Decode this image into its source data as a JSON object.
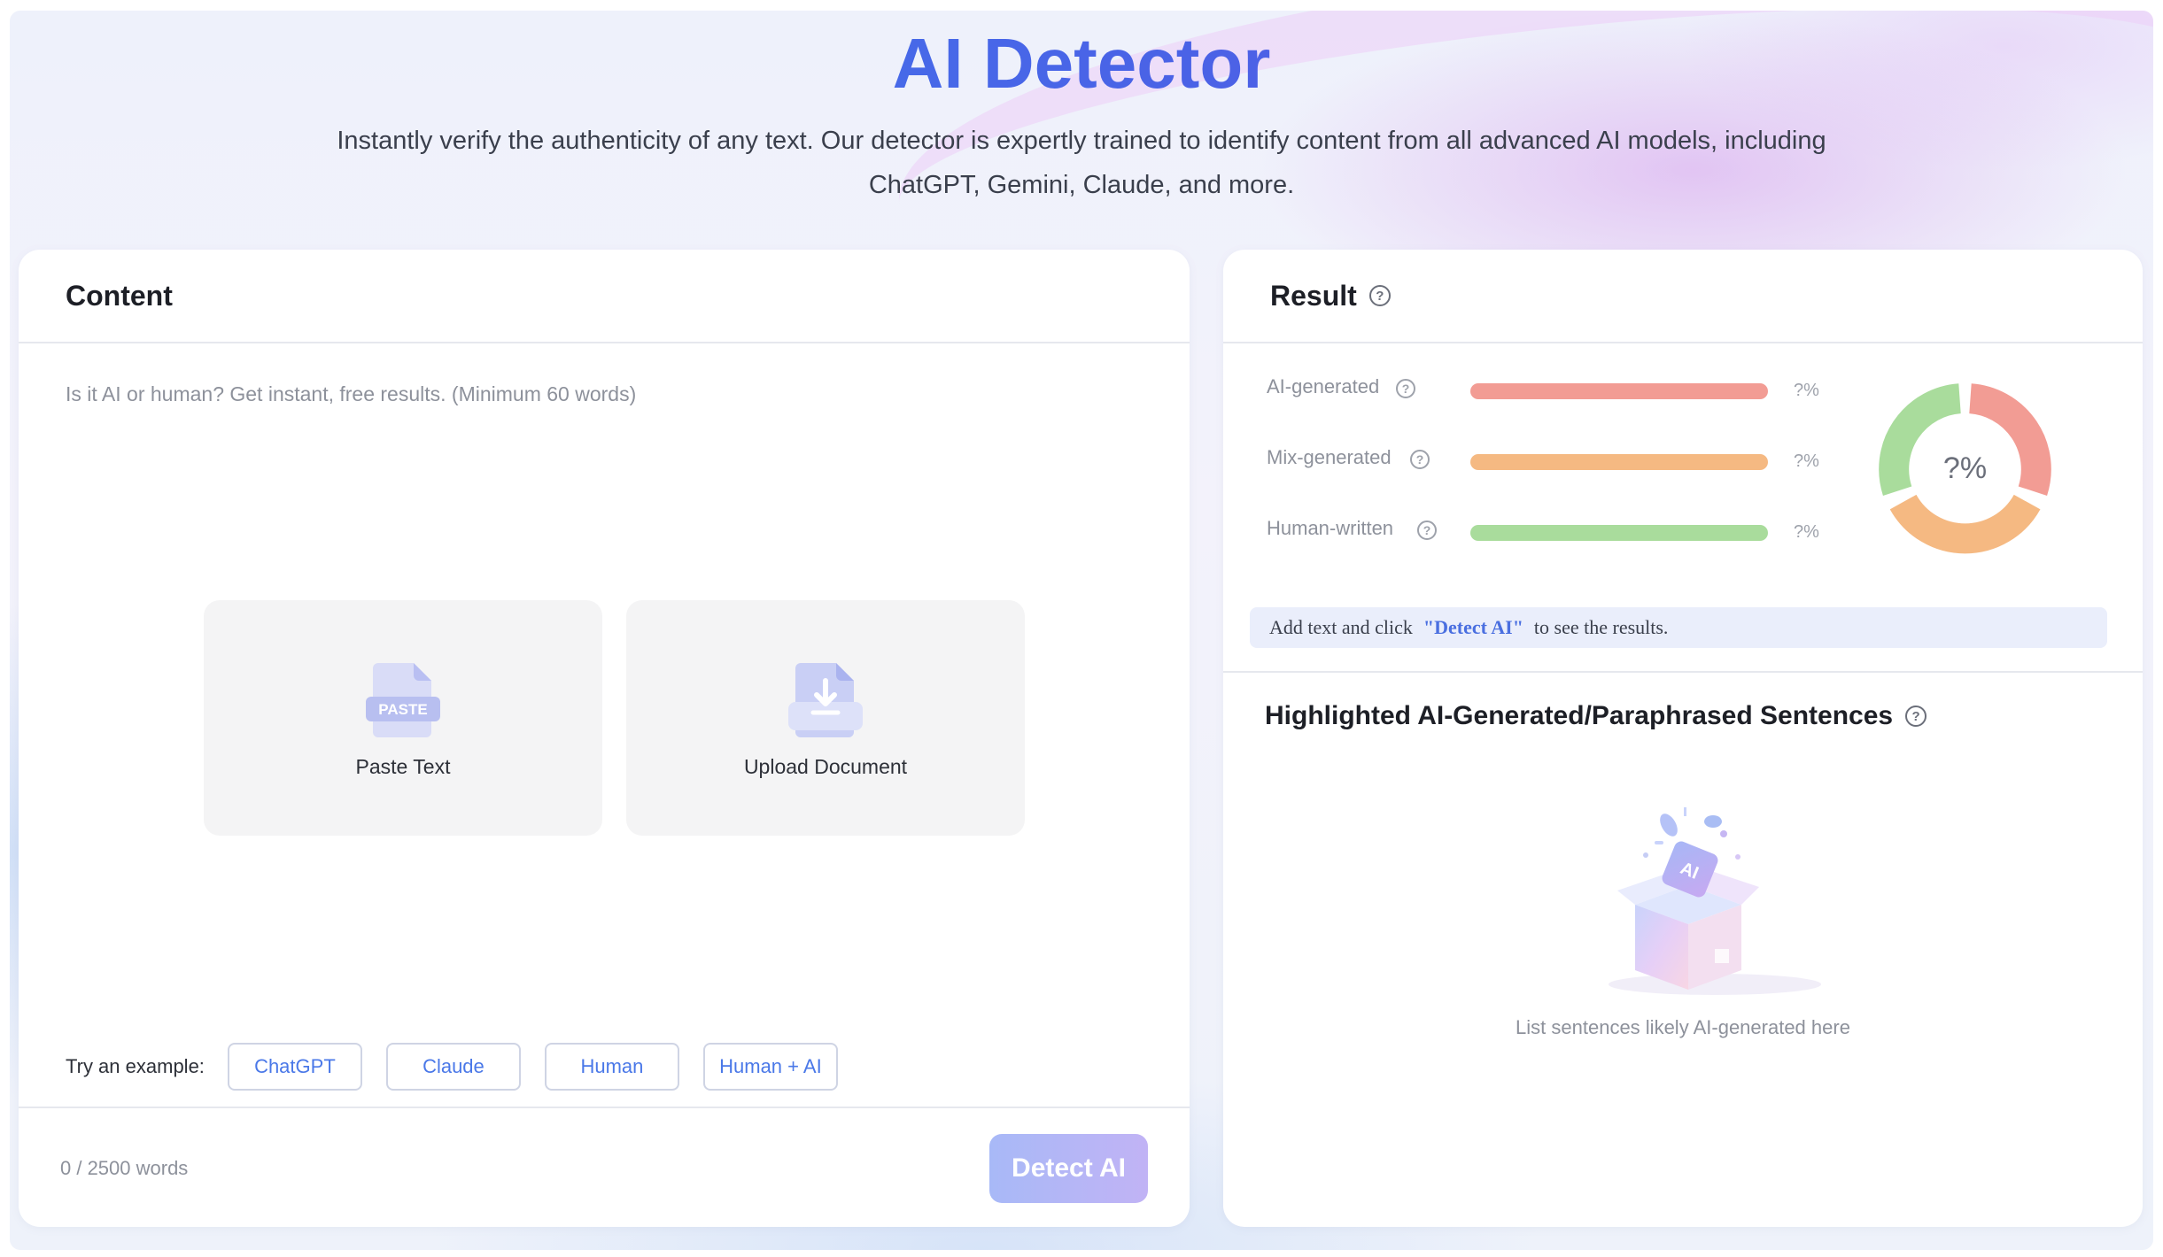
{
  "header": {
    "title": "AI Detector",
    "subtitle_line1": "Instantly verify the authenticity of any text. Our detector is expertly trained to identify content from all advanced AI models, including",
    "subtitle_line2": "ChatGPT, Gemini, Claude, and more."
  },
  "content_panel": {
    "title": "Content",
    "placeholder": "Is it AI or human? Get instant, free results. (Minimum 60 words)",
    "paste_label": "Paste Text",
    "paste_icon_text": "PASTE",
    "upload_label": "Upload Document",
    "examples_label": "Try an example:",
    "examples": [
      "ChatGPT",
      "Claude",
      "Human",
      "Human + AI"
    ],
    "word_count": "0 / 2500 words",
    "detect_button": "Detect AI"
  },
  "result_panel": {
    "title": "Result",
    "metrics": [
      {
        "label": "AI-generated",
        "value": "?%",
        "color": "#f29c94"
      },
      {
        "label": "Mix-generated",
        "value": "?%",
        "color": "#f5b982"
      },
      {
        "label": "Human-written",
        "value": "?%",
        "color": "#a9dc9c"
      }
    ],
    "donut_label": "?%",
    "banner_prefix": "Add text and click",
    "banner_highlight": "\"Detect AI\"",
    "banner_suffix": "to see the results.",
    "highlight_title": "Highlighted AI-Generated/Paraphrased Sentences",
    "empty_text": "List sentences likely AI-generated here",
    "illustration_text": "AI"
  },
  "icons": {
    "help": "question-circle-icon",
    "paste": "paste-document-icon",
    "upload": "upload-document-icon",
    "illustration": "open-box-illustration"
  }
}
